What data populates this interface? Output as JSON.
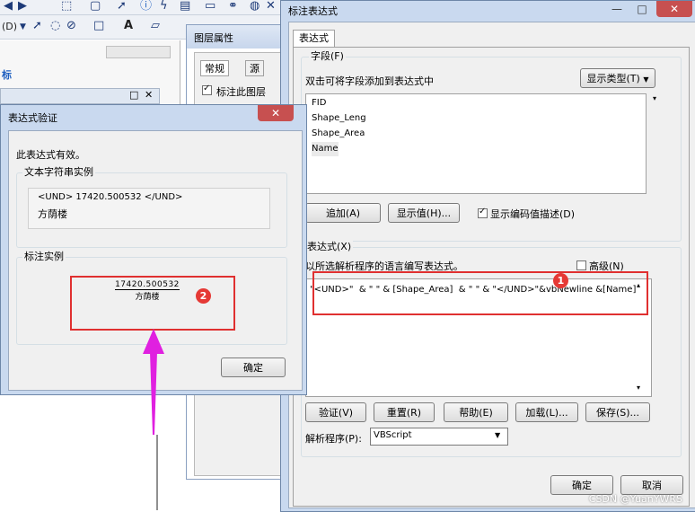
{
  "toolbar": {
    "row1_icons": [
      "arrow-left-icon",
      "arrow-right-icon",
      "info-icon",
      "binoculars-icon"
    ],
    "row2": {
      "dropdown_label": "(D)",
      "text_tool": "A"
    }
  },
  "tree": {
    "partial_label": "标"
  },
  "floating_panel": {
    "restore": "□",
    "close": "✕"
  },
  "layer_props": {
    "title": "图层属性",
    "tabs": [
      "常规",
      "源"
    ],
    "checkbox_label": "标注此图层"
  },
  "main_dialog": {
    "title": "标注表达式",
    "tab": "表达式",
    "fields_group": "字段(F)",
    "fields_hint": "双击可将字段添加到表达式中",
    "show_type_button": "显示类型(T)",
    "fields": [
      "FID",
      "Shape_Leng",
      "Shape_Area",
      "Name"
    ],
    "add_button": "追加(A)",
    "show_values_button": "显示值(H)...",
    "show_coded_label": "显示编码值描述(D)",
    "show_coded_checked": true,
    "expression_group": "表达式(X)",
    "expression_hint": "以所选解析程序的语言编写表达式。",
    "advanced_label": "高级(N)",
    "advanced_checked": false,
    "expression": "\"<UND>\"  & \" \" & [Shape_Area]  & \" \" & \"</UND>\"&vbNewline &[Name]",
    "verify_button": "验证(V)",
    "reset_button": "重置(R)",
    "help_button": "帮助(E)",
    "load_button": "加载(L)...",
    "save_button": "保存(S)...",
    "parser_label": "解析程序(P):",
    "parser_value": "VBScript",
    "ok_button": "确定",
    "cancel_button": "取消",
    "close": "✕",
    "maximize": "□",
    "minimize": "—"
  },
  "verify_dialog": {
    "title": "表达式验证",
    "close": "✕",
    "valid_message": "此表达式有效。",
    "text_sample_group": "文本字符串实例",
    "text_sample_line1": "<UND> 17420.500532 </UND>",
    "text_sample_line2": "方荫楼",
    "label_sample_group": "标注实例",
    "label_sample_line1": "17420.500532",
    "label_sample_line2": "方荫楼",
    "ok_button": "确定"
  },
  "annotations": {
    "badge1": "1",
    "badge2": "2",
    "arrow_color": "#e020e0",
    "highlight_color": "#e03030"
  },
  "watermark": "CSDN @YuanYWRS"
}
